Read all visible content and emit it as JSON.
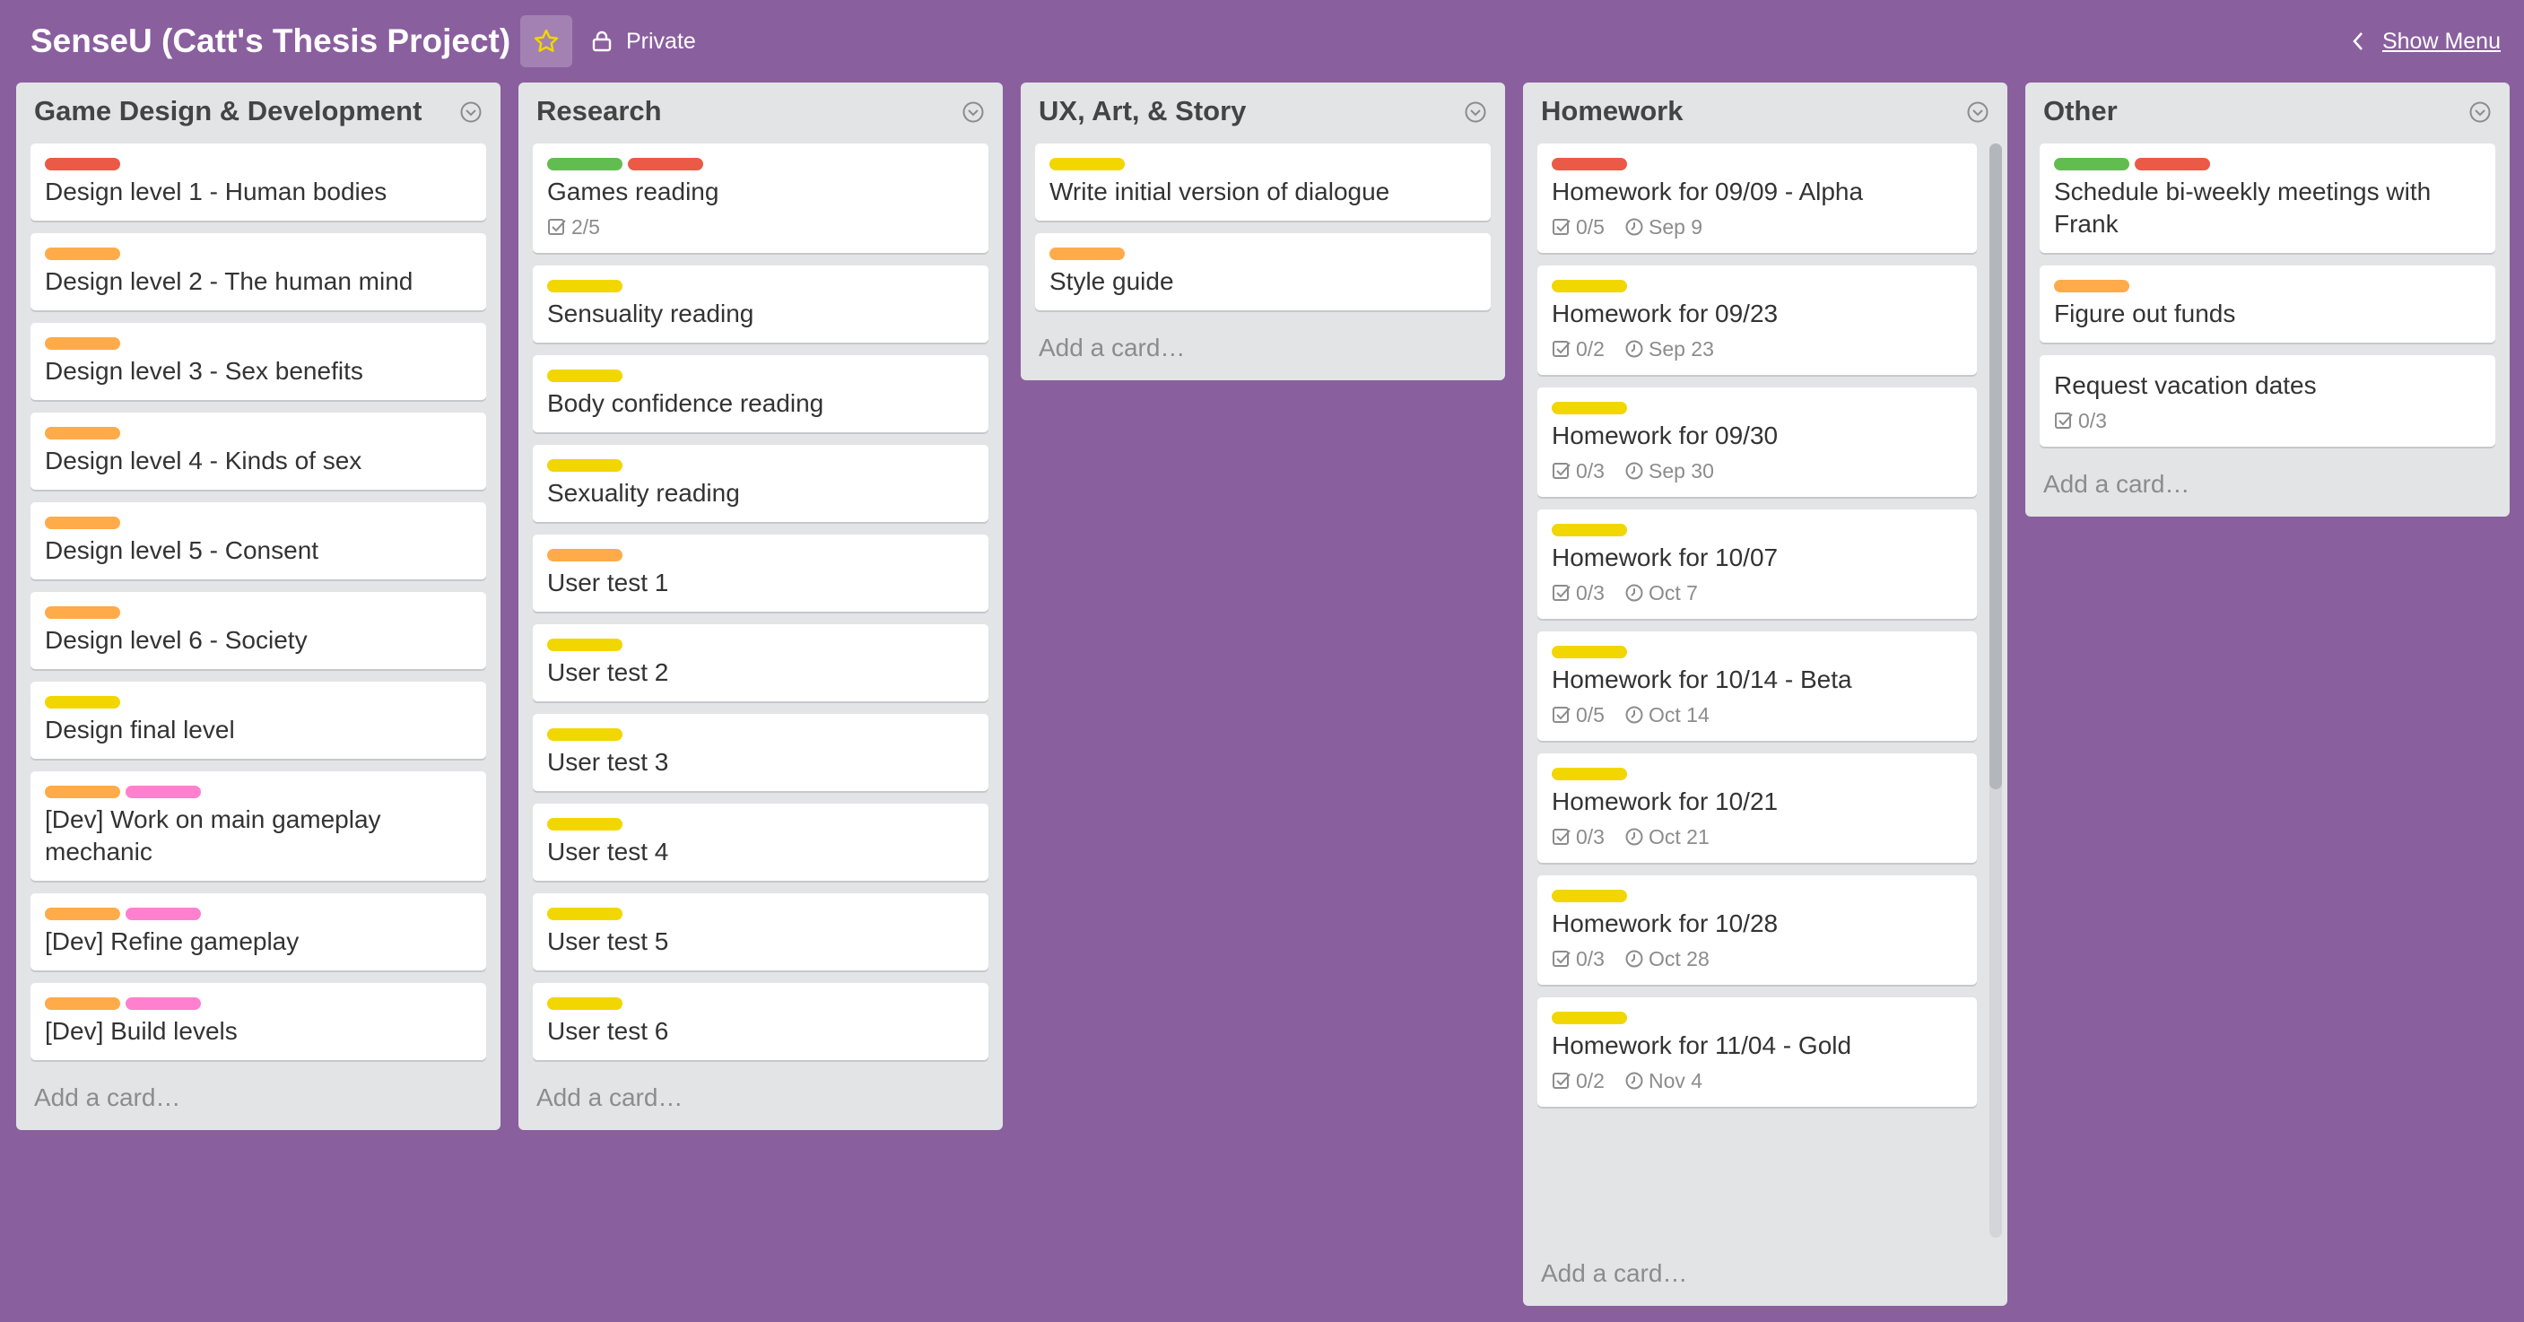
{
  "board": {
    "title": "SenseU (Catt's Thesis Project)",
    "visibility": "Private",
    "show_menu": "Show Menu",
    "icons": {
      "star": "star-icon",
      "lock": "lock-icon",
      "chevron": "chevron-left-icon"
    },
    "colors": {
      "background": "#8a5f9e",
      "star": "#f2d600"
    }
  },
  "label_colors": {
    "red": "#eb5a46",
    "orange": "#ffab4a",
    "yellow": "#f2d600",
    "green": "#61bd4f",
    "pink": "#ff80ce"
  },
  "add_card_label": "Add a card…",
  "lists": [
    {
      "title": "Game Design & Development",
      "cards": [
        {
          "title": "Design level 1 - Human bodies",
          "labels": [
            "red"
          ]
        },
        {
          "title": "Design level 2 - The human mind",
          "labels": [
            "orange"
          ]
        },
        {
          "title": "Design level 3 - Sex benefits",
          "labels": [
            "orange"
          ]
        },
        {
          "title": "Design level 4 - Kinds of sex",
          "labels": [
            "orange"
          ]
        },
        {
          "title": "Design level 5 - Consent",
          "labels": [
            "orange"
          ]
        },
        {
          "title": "Design level 6 - Society",
          "labels": [
            "orange"
          ]
        },
        {
          "title": "Design final level",
          "labels": [
            "yellow"
          ]
        },
        {
          "title": "[Dev] Work on main gameplay mechanic",
          "labels": [
            "orange",
            "pink"
          ]
        },
        {
          "title": "[Dev] Refine gameplay",
          "labels": [
            "orange",
            "pink"
          ]
        },
        {
          "title": "[Dev] Build levels",
          "labels": [
            "orange",
            "pink"
          ]
        }
      ]
    },
    {
      "title": "Research",
      "cards": [
        {
          "title": "Games reading",
          "labels": [
            "green",
            "red"
          ],
          "checklist": "2/5"
        },
        {
          "title": "Sensuality reading",
          "labels": [
            "yellow"
          ]
        },
        {
          "title": "Body confidence reading",
          "labels": [
            "yellow"
          ]
        },
        {
          "title": "Sexuality reading",
          "labels": [
            "yellow"
          ]
        },
        {
          "title": "User test 1",
          "labels": [
            "orange"
          ]
        },
        {
          "title": "User test 2",
          "labels": [
            "yellow"
          ]
        },
        {
          "title": "User test 3",
          "labels": [
            "yellow"
          ]
        },
        {
          "title": "User test 4",
          "labels": [
            "yellow"
          ]
        },
        {
          "title": "User test 5",
          "labels": [
            "yellow"
          ]
        },
        {
          "title": "User test 6",
          "labels": [
            "yellow"
          ]
        }
      ]
    },
    {
      "title": "UX, Art, & Story",
      "cards": [
        {
          "title": "Write initial version of dialogue",
          "labels": [
            "yellow"
          ]
        },
        {
          "title": "Style guide",
          "labels": [
            "orange"
          ]
        }
      ]
    },
    {
      "title": "Homework",
      "cards": [
        {
          "title": "Homework for 09/09 - Alpha",
          "labels": [
            "red"
          ],
          "checklist": "0/5",
          "due": "Sep 9"
        },
        {
          "title": "Homework for 09/23",
          "labels": [
            "yellow"
          ],
          "checklist": "0/2",
          "due": "Sep 23"
        },
        {
          "title": "Homework for 09/30",
          "labels": [
            "yellow"
          ],
          "checklist": "0/3",
          "due": "Sep 30"
        },
        {
          "title": "Homework for 10/07",
          "labels": [
            "yellow"
          ],
          "checklist": "0/3",
          "due": "Oct 7"
        },
        {
          "title": "Homework for 10/14 - Beta",
          "labels": [
            "yellow"
          ],
          "checklist": "0/5",
          "due": "Oct 14"
        },
        {
          "title": "Homework for 10/21",
          "labels": [
            "yellow"
          ],
          "checklist": "0/3",
          "due": "Oct 21"
        },
        {
          "title": "Homework for 10/28",
          "labels": [
            "yellow"
          ],
          "checklist": "0/3",
          "due": "Oct 28"
        },
        {
          "title": "Homework for 11/04 - Gold",
          "labels": [
            "yellow"
          ],
          "checklist": "0/2",
          "due": "Nov 4"
        }
      ]
    },
    {
      "title": "Other",
      "cards": [
        {
          "title": "Schedule bi-weekly meetings with Frank",
          "labels": [
            "green",
            "red"
          ]
        },
        {
          "title": "Figure out funds",
          "labels": [
            "orange"
          ]
        },
        {
          "title": "Request vacation dates",
          "labels": [],
          "checklist": "0/3"
        }
      ]
    }
  ]
}
